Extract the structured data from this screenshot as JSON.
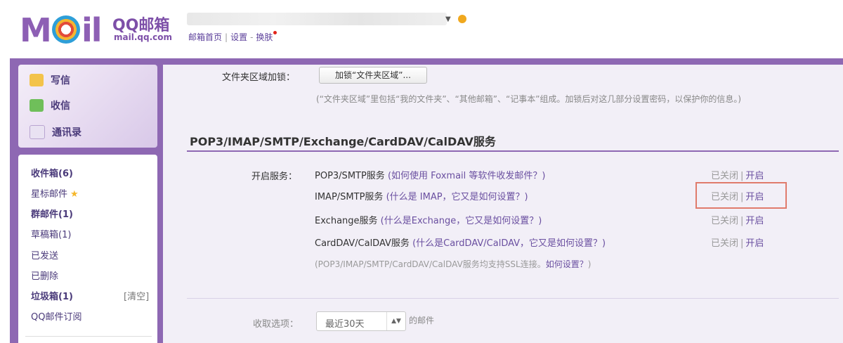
{
  "header": {
    "logo_qq": "QQ邮箱",
    "logo_domain": "mail.qq.com",
    "links": [
      "邮箱首页",
      "设置",
      "换肤"
    ]
  },
  "sidebar": {
    "actions": [
      {
        "label": "写信",
        "icon": "pencil-icon"
      },
      {
        "label": "收信",
        "icon": "inbox-download-icon"
      },
      {
        "label": "通讯录",
        "icon": "address-book-icon"
      }
    ],
    "folders": [
      {
        "label": "收件箱(6)",
        "bold": true
      },
      {
        "label": "星标邮件",
        "star": "★",
        "bold": false
      },
      {
        "label": "群邮件(1)",
        "bold": true
      },
      {
        "label": "草稿箱(1)",
        "bold": false
      },
      {
        "label": "已发送",
        "bold": false
      },
      {
        "label": "已删除",
        "bold": false
      },
      {
        "label": "垃圾箱(1)",
        "bold": true,
        "action": "[清空]"
      },
      {
        "label": "QQ邮件订阅",
        "bold": false
      }
    ]
  },
  "main": {
    "folder_label": "文件夹区域加锁：",
    "folder_button": "加锁“文件夹区域”...",
    "folder_note": "(“文件夹区域”里包括“我的文件夹”、“其他邮箱”、“记事本”组成。加锁后对这几部分设置密码，以保护你的信息。)",
    "section_title": "POP3/IMAP/SMTP/Exchange/CardDAV/CalDAV服务",
    "services_label": "开启服务：",
    "services": [
      {
        "name": "POP3/SMTP服务",
        "help": "(如何使用 Foxmail 等软件收发邮件？)",
        "off": "已关闭",
        "on": "开启"
      },
      {
        "name": "IMAP/SMTP服务",
        "help": "(什么是 IMAP，它又是如何设置？)",
        "off": "已关闭",
        "on": "开启"
      },
      {
        "name": "Exchange服务",
        "help": "(什么是Exchange，它又是如何设置？)",
        "off": "已关闭",
        "on": "开启"
      },
      {
        "name": "CardDAV/CalDAV服务",
        "help": "(什么是CardDAV/CalDAV，它又是如何设置？)",
        "off": "已关闭",
        "on": "开启"
      }
    ],
    "ssl_note_text": "(POP3/IMAP/SMTP/CardDAV/CalDAV服务均支持SSL连接。",
    "ssl_note_link": "如何设置？",
    "ssl_note_end": ")",
    "receive_label": "收取选项：",
    "receive_value": "最近30天",
    "receive_suffix": "的邮件"
  },
  "colors": {
    "frame": "#8e68b3",
    "accent": "#6a4fa0",
    "highlight": "#e07b6c"
  }
}
